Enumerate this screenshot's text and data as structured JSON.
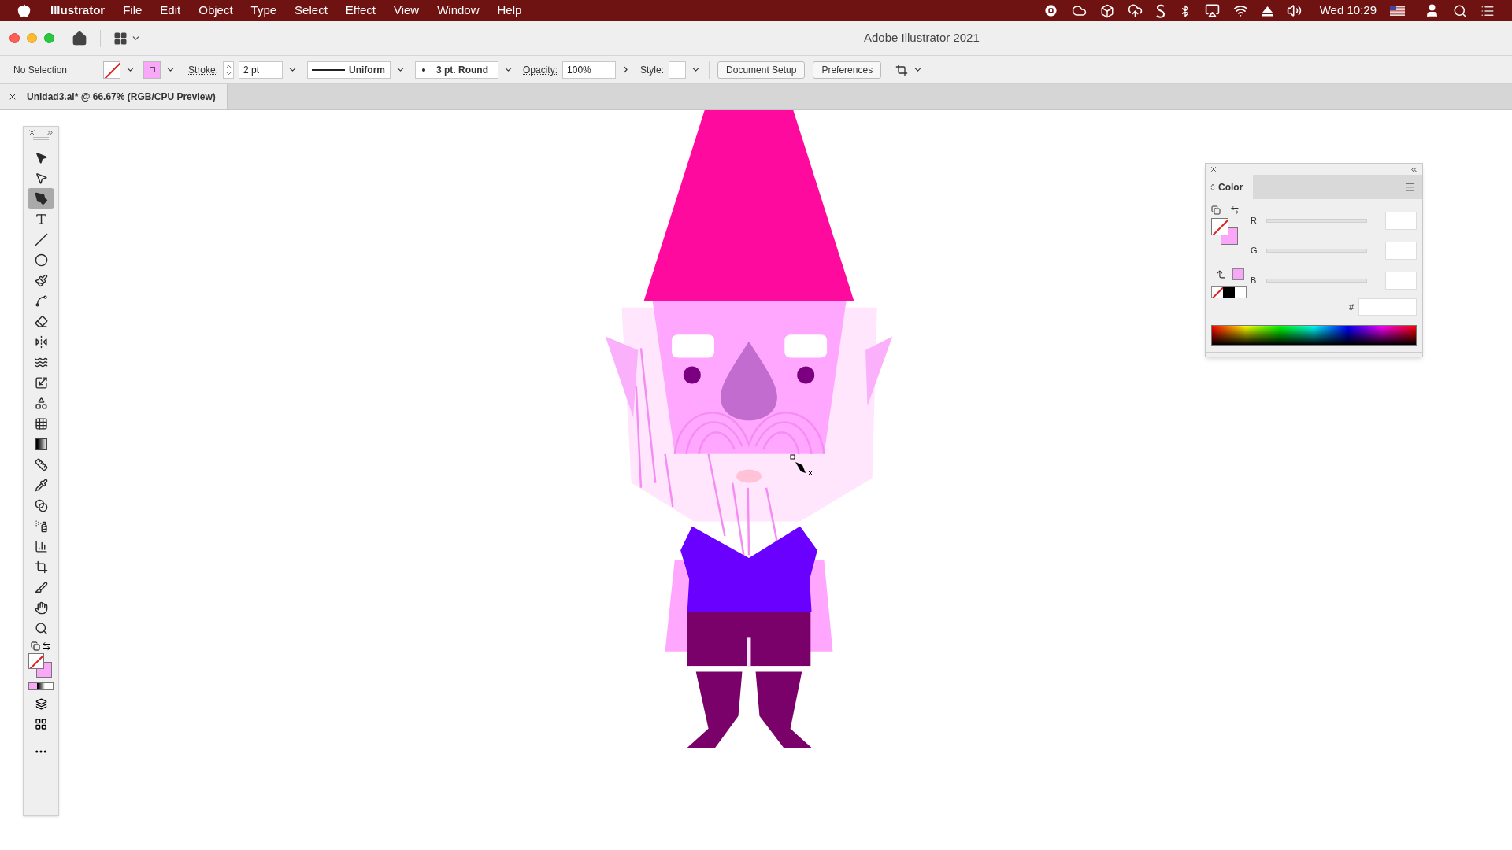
{
  "menu_bar": {
    "app_name": "Illustrator",
    "menus": [
      "File",
      "Edit",
      "Object",
      "Type",
      "Select",
      "Effect",
      "View",
      "Window",
      "Help"
    ],
    "clock": "Wed 10:29"
  },
  "window": {
    "title": "Adobe Illustrator 2021"
  },
  "control_bar": {
    "selection": "No Selection",
    "stroke_label": "Stroke:",
    "stroke_weight": "2 pt",
    "profile": "Uniform",
    "brush": "3 pt. Round",
    "opacity_label": "Opacity:",
    "opacity": "100%",
    "style_label": "Style:",
    "buttons": [
      "Document Setup",
      "Preferences"
    ]
  },
  "document_tab": {
    "title": "Unidad3.ai* @ 66.67% (RGB/CPU Preview)"
  },
  "tools": [
    {
      "kind": "selection",
      "selected": false
    },
    {
      "kind": "direct",
      "selected": false
    },
    {
      "kind": "pen",
      "selected": true
    },
    {
      "kind": "type",
      "selected": false
    },
    {
      "kind": "line",
      "selected": false
    },
    {
      "kind": "ellipse",
      "selected": false
    },
    {
      "kind": "brush",
      "selected": false
    },
    {
      "kind": "shaper",
      "selected": false
    },
    {
      "kind": "eraser",
      "selected": false
    },
    {
      "kind": "reflect",
      "selected": false
    },
    {
      "kind": "warp",
      "selected": false
    },
    {
      "kind": "scale",
      "selected": false
    },
    {
      "kind": "shapes",
      "selected": false
    },
    {
      "kind": "mesh",
      "selected": false
    },
    {
      "kind": "gradient",
      "selected": false
    },
    {
      "kind": "ruler",
      "selected": false
    },
    {
      "kind": "eyedropper",
      "selected": false
    },
    {
      "kind": "blend",
      "selected": false
    },
    {
      "kind": "spray",
      "selected": false
    },
    {
      "kind": "graph",
      "selected": false
    },
    {
      "kind": "artboard",
      "selected": false
    },
    {
      "kind": "knife",
      "selected": false
    },
    {
      "kind": "hand",
      "selected": false
    },
    {
      "kind": "zoom",
      "selected": false
    }
  ],
  "color_panel": {
    "title": "Color",
    "channels": [
      {
        "label": "R",
        "level": 0
      },
      {
        "label": "G",
        "level": 0
      },
      {
        "label": "B",
        "level": 0
      }
    ],
    "hex_label": "#"
  }
}
